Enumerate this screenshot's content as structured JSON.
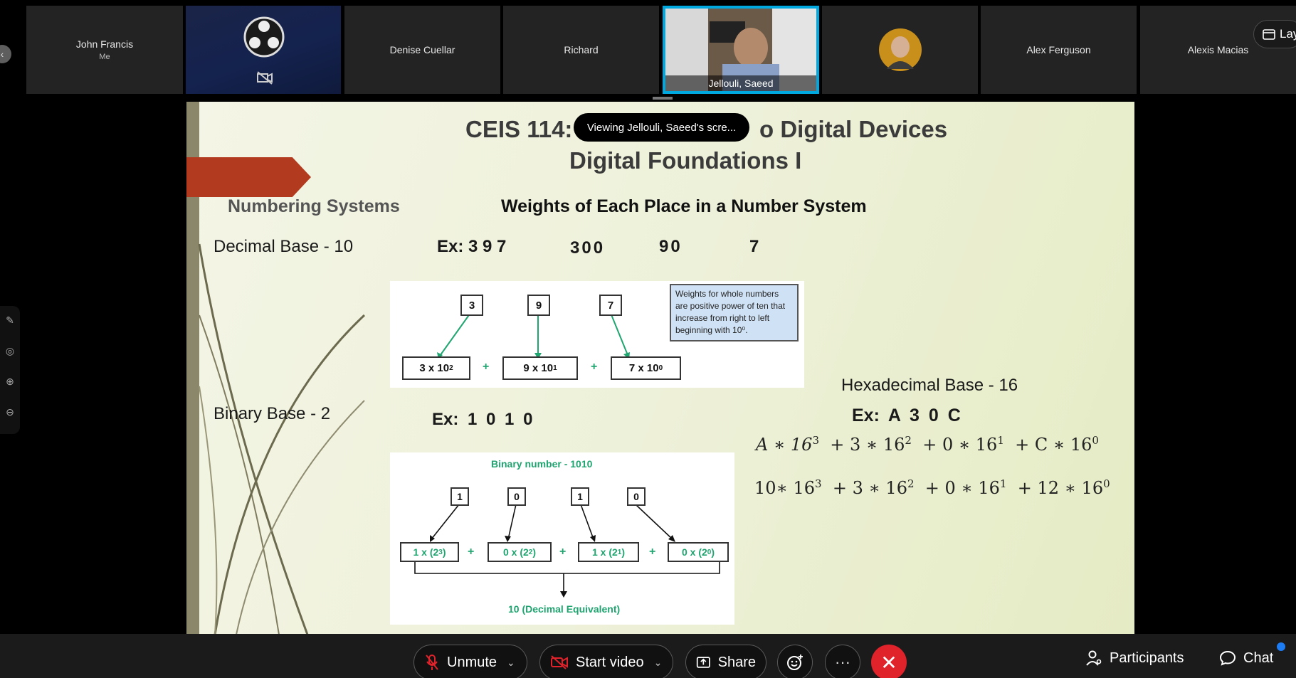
{
  "participants": [
    {
      "name": "John Francis",
      "sub": "Me"
    },
    {
      "name": "",
      "sub": ""
    },
    {
      "name": "Denise Cuellar"
    },
    {
      "name": "Richard"
    },
    {
      "name": "Jellouli, Saeed"
    },
    {
      "name": ""
    },
    {
      "name": "Alex Ferguson"
    },
    {
      "name": "Alexis Macias"
    }
  ],
  "layout_button": {
    "label": "Lay"
  },
  "toast": "Viewing Jellouli, Saeed's scre...",
  "slide": {
    "title_line1_left": "CEIS 114:",
    "title_line1_right": "o Digital Devices",
    "title_line2": "Digital Foundations I",
    "numbering": "Numbering Systems",
    "weights": "Weights of Each Place in a Number System",
    "decimal_label": "Decimal Base - 10",
    "decimal_example": "Ex: 3 9 7",
    "decimal_300": "300",
    "decimal_90": "90",
    "decimal_7": "7",
    "decimal_digits": [
      "3",
      "9",
      "7"
    ],
    "decimal_terms": [
      {
        "base": "3 x 10",
        "exp": "2"
      },
      {
        "base": "9 x 10",
        "exp": "1"
      },
      {
        "base": "7 x 10",
        "exp": "0"
      }
    ],
    "plus": "+",
    "note": "Weights for whole numbers are positive power of ten that increase from right to left beginning with 10⁰.",
    "binary_label": "Binary Base - 2",
    "binary_example": "Ex: 1 0 1 0",
    "binary_caption": "Binary number - 1010",
    "binary_digits": [
      "1",
      "0",
      "1",
      "0"
    ],
    "binary_terms": [
      {
        "base": "1 x (2",
        "exp": "3",
        "close": ")"
      },
      {
        "base": "0 x (2",
        "exp": "2",
        "close": ")"
      },
      {
        "base": "1 x (2",
        "exp": "1",
        "close": ")"
      },
      {
        "base": "0 x (2",
        "exp": "0",
        "close": ")"
      }
    ],
    "binary_result": "10 (Decimal Equivalent)",
    "hex_label": "Hexadecimal Base - 16",
    "hex_example": "Ex: A 3 0 C",
    "hex_row1": [
      "A ∗ 16",
      "+ 3 ∗ 16",
      "+ 0 ∗ 16",
      "+ C ∗ 16"
    ],
    "hex_row2": [
      "10∗ 16",
      "+ 3 ∗ 16",
      "+ 0 ∗ 16",
      "+ 12 ∗ 16"
    ],
    "hex_exps": [
      "3",
      "2",
      "1",
      "0"
    ]
  },
  "toolbar": {
    "unmute": "Unmute",
    "start_video": "Start video",
    "share": "Share",
    "more": "···",
    "end": "✕",
    "participants": "Participants",
    "chat": "Chat"
  },
  "colors": {
    "accent_blue": "#00a8e0",
    "end_red": "#e0222b",
    "slide_green": "#1fa56f",
    "slide_arrow": "#b23b1f"
  },
  "icons": [
    "chevron-left-icon",
    "camera-off-icon",
    "obs-logo-icon",
    "calendar-icon",
    "draw-icon",
    "cast-icon",
    "zoom-in-icon",
    "zoom-out-icon",
    "mic-off-icon",
    "video-off-icon",
    "share-icon",
    "reaction-icon",
    "more-icon",
    "end-call-icon",
    "participants-icon",
    "chat-icon"
  ]
}
